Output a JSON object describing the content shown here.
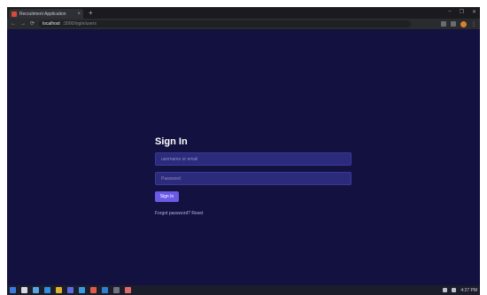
{
  "browser": {
    "tab_title": "Recruitment Application",
    "tab_close": "×",
    "new_tab": "+",
    "minimize": "–",
    "maximize": "❐",
    "close": "✕",
    "back": "←",
    "forward": "→",
    "reload": "⟳",
    "url_host": "localhost",
    "url_path": ":3000/login/users",
    "menu": "⋮"
  },
  "page": {
    "heading": "Sign In",
    "email_placeholder": "username or email",
    "password_placeholder": "Password",
    "submit_label": "Sign In",
    "forgot_link": "Forgot password? Reset"
  },
  "taskbar": {
    "icons": [
      "start-icon",
      "search-icon",
      "taskview-icon",
      "edge-icon",
      "explorer-icon",
      "store-icon",
      "mail-icon",
      "chrome-icon",
      "vscode-icon",
      "terminal-icon",
      "app-icon"
    ],
    "icon_colors": [
      "#3a7be0",
      "#d8d8e0",
      "#58a6e0",
      "#2f8fe0",
      "#e0b030",
      "#5a6ae0",
      "#3a9ae0",
      "#e05a4a",
      "#2f7fd0",
      "#707080",
      "#e06a6a"
    ],
    "clock": "4:27 PM"
  },
  "colors": {
    "page_bg": "#13113f",
    "field_bg": "#2c2a7a",
    "button_bg": "#6a5ae6"
  }
}
